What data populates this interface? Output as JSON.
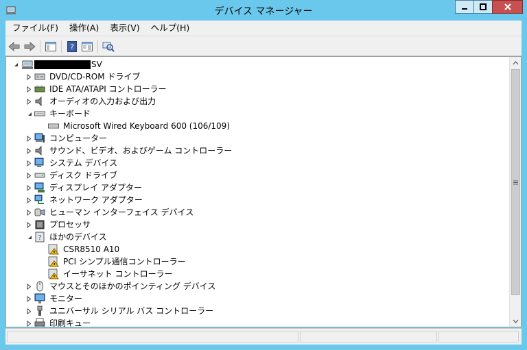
{
  "window": {
    "title": "デバイス マネージャー",
    "titlebar_color": "#6ac8ec",
    "close_color": "#c75050"
  },
  "menu": {
    "items": [
      {
        "label": "ファイル(F)"
      },
      {
        "label": "操作(A)"
      },
      {
        "label": "表示(V)"
      },
      {
        "label": "ヘルプ(H)"
      }
    ]
  },
  "toolbar": {
    "buttons": [
      "back-arrow-icon",
      "forward-arrow-icon",
      "show-hide-console-tree-icon",
      "help-icon",
      "properties-view-icon",
      "scan-hardware-changes-icon"
    ]
  },
  "tree": {
    "root": {
      "label_suffix": "SV",
      "expanded": true
    },
    "nodes": [
      {
        "label": "DVD/CD-ROM ドライブ",
        "icon": "dvd-drive-icon",
        "expanded": false
      },
      {
        "label": "IDE ATA/ATAPI コントローラー",
        "icon": "ide-controller-icon",
        "expanded": false
      },
      {
        "label": "オーディオの入力および出力",
        "icon": "speaker-icon",
        "expanded": false
      },
      {
        "label": "キーボード",
        "icon": "keyboard-icon",
        "expanded": true
      },
      {
        "label": "Microsoft Wired Keyboard 600 (106/109)",
        "icon": "keyboard-icon",
        "child": true
      },
      {
        "label": "コンピューター",
        "icon": "computer-icon",
        "expanded": false
      },
      {
        "label": "サウンド、ビデオ、およびゲーム コントローラー",
        "icon": "speaker-icon",
        "expanded": false
      },
      {
        "label": "システム デバイス",
        "icon": "system-device-icon",
        "expanded": false
      },
      {
        "label": "ディスク ドライブ",
        "icon": "disk-drive-icon",
        "expanded": false
      },
      {
        "label": "ディスプレイ アダプター",
        "icon": "display-adapter-icon",
        "expanded": false
      },
      {
        "label": "ネットワーク アダプター",
        "icon": "network-adapter-icon",
        "expanded": false
      },
      {
        "label": "ヒューマン インターフェイス デバイス",
        "icon": "hid-icon",
        "expanded": false
      },
      {
        "label": "プロセッサ",
        "icon": "processor-icon",
        "expanded": false
      },
      {
        "label": "ほかのデバイス",
        "icon": "unknown-device-icon",
        "expanded": true
      },
      {
        "label": "CSR8510 A10",
        "icon": "warning-device-icon",
        "child": true
      },
      {
        "label": "PCI シンプル通信コントローラー",
        "icon": "warning-device-icon",
        "child": true
      },
      {
        "label": "イーサネット コントローラー",
        "icon": "warning-device-icon",
        "child": true
      },
      {
        "label": "マウスとそのほかのポインティング デバイス",
        "icon": "mouse-icon",
        "expanded": false
      },
      {
        "label": "モニター",
        "icon": "monitor-icon",
        "expanded": false
      },
      {
        "label": "ユニバーサル シリアル バス コントローラー",
        "icon": "usb-icon",
        "expanded": false
      },
      {
        "label": "印刷キュー",
        "icon": "printer-icon",
        "expanded": false
      }
    ]
  }
}
